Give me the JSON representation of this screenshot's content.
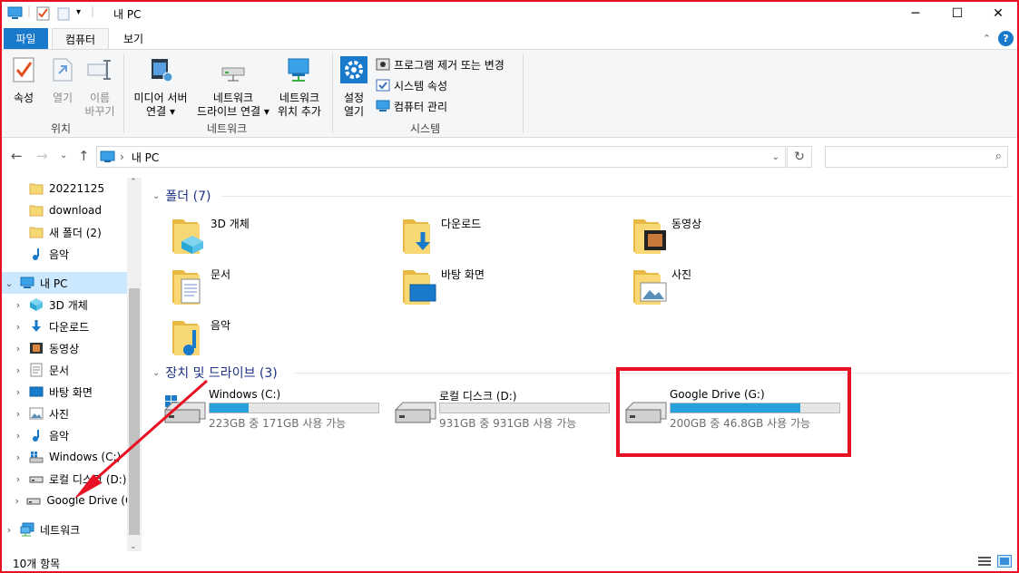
{
  "window": {
    "title": "내 PC"
  },
  "ribbon_tabs": {
    "file": "파일",
    "computer": "컴퓨터",
    "view": "보기"
  },
  "ribbon": {
    "location": {
      "properties": "속성",
      "open": "열기",
      "rename_1": "이름",
      "rename_2": "바꾸기",
      "group": "위치"
    },
    "network": {
      "media_1": "미디어 서버",
      "media_2": "연결",
      "map_1": "네트워크",
      "map_2": "드라이브 연결",
      "add_1": "네트워크",
      "add_2": "위치 추가",
      "group": "네트워크"
    },
    "system": {
      "settings_1": "설정",
      "settings_2": "열기",
      "uninstall": "프로그램 제거 또는 변경",
      "sys_props": "시스템 속성",
      "manage": "컴퓨터 관리",
      "group": "시스템"
    }
  },
  "address": {
    "crumb": "내 PC",
    "search_placeholder": ""
  },
  "sidebar": {
    "items": [
      {
        "label": "20221125",
        "icon": "folder-icon"
      },
      {
        "label": "download",
        "icon": "folder-icon"
      },
      {
        "label": "새 폴더 (2)",
        "icon": "folder-icon"
      },
      {
        "label": "음악",
        "icon": "music-icon"
      },
      {
        "label": "내 PC",
        "icon": "pc-icon"
      },
      {
        "label": "3D 개체",
        "icon": "3d-objects-icon"
      },
      {
        "label": "다운로드",
        "icon": "download-icon"
      },
      {
        "label": "동영상",
        "icon": "video-icon"
      },
      {
        "label": "문서",
        "icon": "document-icon"
      },
      {
        "label": "바탕 화면",
        "icon": "desktop-icon"
      },
      {
        "label": "사진",
        "icon": "pictures-icon"
      },
      {
        "label": "음악",
        "icon": "music-icon"
      },
      {
        "label": "Windows (C:)",
        "icon": "windows-drive-icon"
      },
      {
        "label": "로컬 디스크 (D:)",
        "icon": "drive-icon"
      },
      {
        "label": "Google Drive (G:)",
        "icon": "drive-icon"
      },
      {
        "label": "네트워크",
        "icon": "network-icon"
      }
    ]
  },
  "folders_section": {
    "title": "폴더 (7)"
  },
  "folders": [
    {
      "name": "3D 개체",
      "icon": "3d-objects-icon"
    },
    {
      "name": "다운로드",
      "icon": "download-icon"
    },
    {
      "name": "동영상",
      "icon": "video-icon"
    },
    {
      "name": "문서",
      "icon": "document-icon"
    },
    {
      "name": "바탕 화면",
      "icon": "desktop-icon"
    },
    {
      "name": "사진",
      "icon": "pictures-icon"
    },
    {
      "name": "음악",
      "icon": "music-icon"
    }
  ],
  "drives_section": {
    "title": "장치 및 드라이브 (3)"
  },
  "drives": [
    {
      "name": "Windows (C:)",
      "free": "223GB 중 171GB 사용 가능",
      "used_fraction": 0.23
    },
    {
      "name": "로컬 디스크 (D:)",
      "free": "931GB 중 931GB 사용 가능",
      "used_fraction": 0.0
    },
    {
      "name": "Google Drive (G:)",
      "free": "200GB 중 46.8GB 사용 가능",
      "used_fraction": 0.77
    }
  ],
  "status": {
    "count": "10개 항목"
  },
  "colors": {
    "accent": "#1979ca",
    "highlight": "#e81123",
    "selected": "#cce8ff",
    "bar_fill": "#26a0da"
  }
}
